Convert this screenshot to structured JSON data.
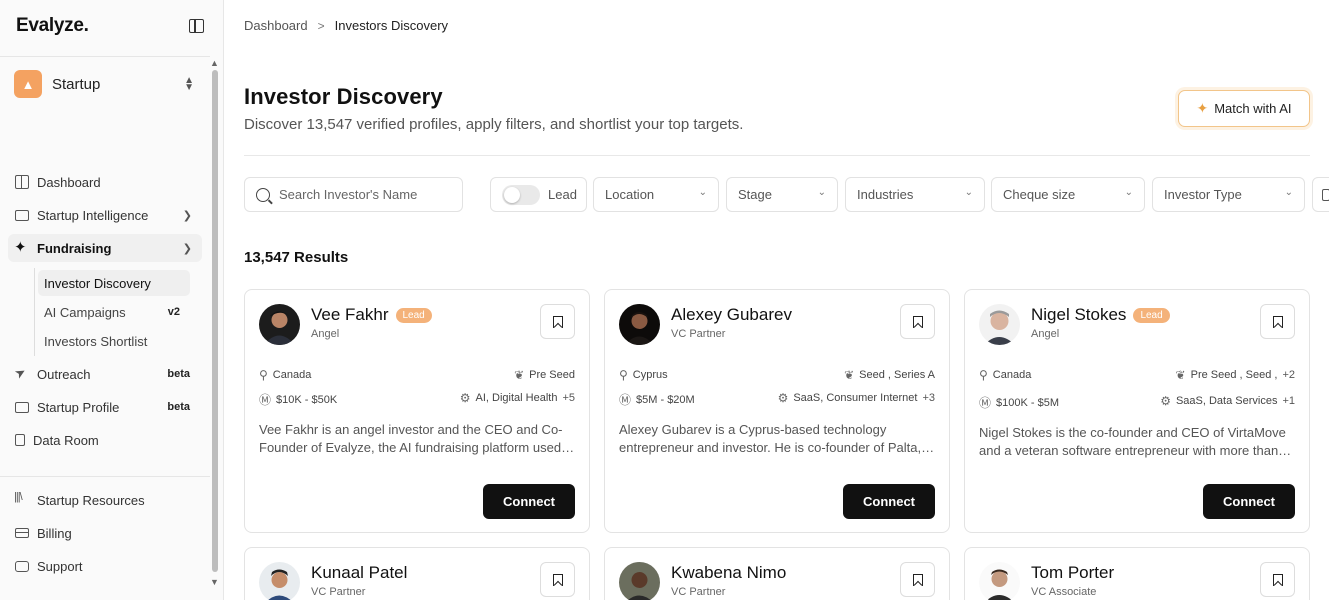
{
  "app": {
    "logo": "Evalyze",
    "logo_dot": "."
  },
  "workspace": {
    "name": "Startup",
    "icon": "rocket-icon"
  },
  "sidebar": {
    "items": [
      {
        "label": "Dashboard",
        "icon": "dashboard-icon"
      },
      {
        "label": "Startup Intelligence",
        "icon": "monitor-icon"
      },
      {
        "label": "Fundraising",
        "icon": "sparkle-icon"
      },
      {
        "label": "Outreach",
        "icon": "send-icon",
        "badge": "beta"
      },
      {
        "label": "Startup Profile",
        "icon": "folder-icon",
        "badge": "beta"
      },
      {
        "label": "Data Room",
        "icon": "documents-icon"
      },
      {
        "label": "Startup Resources",
        "icon": "library-icon"
      },
      {
        "label": "Billing",
        "icon": "credit-card-icon"
      },
      {
        "label": "Support",
        "icon": "chat-icon"
      }
    ],
    "fundraising_sub": [
      {
        "label": "Investor Discovery"
      },
      {
        "label": "AI Campaigns",
        "badge": "v2"
      },
      {
        "label": "Investors Shortlist"
      }
    ]
  },
  "breadcrumb": {
    "root": "Dashboard",
    "separator": ">",
    "current": "Investors Discovery"
  },
  "header": {
    "title": "Investor Discovery",
    "subtitle": "Discover 13,547 verified profiles, apply filters, and shortlist your top targets.",
    "match_button": "Match with AI"
  },
  "filters": {
    "search_placeholder": "Search Investor's Name",
    "lead_label": "Lead",
    "location": "Location",
    "stage": "Stage",
    "industries": "Industries",
    "cheque": "Cheque size",
    "investor_type": "Investor Type"
  },
  "results_label": "13,547 Results",
  "colors": {
    "lead_badge": "#f4b27a",
    "accent_border": "#f2c58a",
    "connect_bg": "#111111"
  },
  "investors": [
    {
      "name": "Vee Fakhr",
      "lead": "Lead",
      "role": "Angel",
      "location": "Canada",
      "stages": "Pre Seed",
      "stages_more": "",
      "cheque": "$10K - $50K",
      "industries": "AI, Digital Health",
      "industries_more": "+5",
      "description": "Vee Fakhr is an angel investor and the CEO and Co-Founder of Evalyze, the AI fundraising platform used by founders worldwide.",
      "connect": "Connect"
    },
    {
      "name": "Alexey Gubarev",
      "lead": "",
      "role": "VC Partner",
      "location": "Cyprus",
      "stages": "Seed , Series A",
      "stages_more": "",
      "cheque": "$5M - $20M",
      "industries": "SaaS, Consumer Internet",
      "industries_more": "+3",
      "description": "Alexey Gubarev is a Cyprus-based technology entrepreneur and investor. He is co-founder of Palta, a digital health company.",
      "connect": "Connect"
    },
    {
      "name": "Nigel Stokes",
      "lead": "Lead",
      "role": "Angel",
      "location": "Canada",
      "stages": "Pre Seed , Seed ,",
      "stages_more": "+2",
      "cheque": "$100K - $5M",
      "industries": "SaaS, Data Services",
      "industries_more": "+1",
      "description": "Nigel Stokes is the co-founder and CEO of VirtaMove and a veteran software entrepreneur with more than three decades of experience.",
      "connect": "Connect"
    },
    {
      "name": "Kunaal Patel",
      "lead": "",
      "role": "VC Partner"
    },
    {
      "name": "Kwabena Nimo",
      "lead": "",
      "role": "VC Partner"
    },
    {
      "name": "Tom Porter",
      "lead": "",
      "role": "VC Associate"
    }
  ]
}
